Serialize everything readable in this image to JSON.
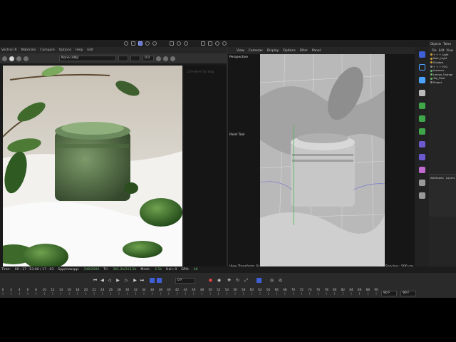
{
  "viewer": {
    "menu": [
      "Vectron R",
      "Materials",
      "Compare",
      "Options",
      "Help",
      "Edit"
    ],
    "camera_select": "None (ANJ)",
    "field_value": "0.0",
    "side_note": "Ctrl+Alt+F for help"
  },
  "viewport": {
    "menu": [
      "View",
      "Cameras",
      "Display",
      "Options",
      "Filter",
      "Panel"
    ],
    "title": "Perspective",
    "tool_label": "Point Tool",
    "view_transform": "View Transform: Scene",
    "grid_spacing": "Grid Spacing : 500 cm"
  },
  "object_manager": {
    "header": [
      "Objects",
      "Takes"
    ],
    "menu": [
      "File",
      "Edit",
      "View"
    ],
    "objects": [
      {
        "name": "+ + + Light",
        "color": "#d9a23b"
      },
      {
        "name": "Main_Light",
        "color": "#d9a23b"
      },
      {
        "name": "Shadow",
        "color": "#d9a23b"
      },
      {
        "name": "+ + + FOG",
        "color": "#8a8a8a"
      },
      {
        "name": "Instance",
        "color": "#6fb86f"
      },
      {
        "name": "Lemon_Orange",
        "color": "#6fb86f"
      },
      {
        "name": "Top_Floor",
        "color": "#6fb86f"
      },
      {
        "name": "Project",
        "color": "#8a8a8a"
      }
    ],
    "attr_tabs": [
      "Attributes",
      "Layers"
    ]
  },
  "status": {
    "time_label": "Time:",
    "time_value": "00 : 17 : 03:00 / 17 : 03",
    "spp_label": "Spp/maxspp:",
    "spp_value": "348/2000",
    "tri_label": "Tri:",
    "tri_value": "361.2k/113.2k",
    "mesh_label": "Mesh:",
    "mesh_value": "4.1k",
    "hair_label": "Hair: 0",
    "gpu_label": "GPU:",
    "gpu_value": "48"
  },
  "timeline": {
    "current_frame": "0 F",
    "end_frame_a": "90 F",
    "end_frame_b": "90 F",
    "ticks": [
      "0",
      "2",
      "4",
      "6",
      "8",
      "10",
      "12",
      "14",
      "16",
      "18",
      "20",
      "22",
      "24",
      "26",
      "28",
      "30",
      "32",
      "34",
      "36",
      "38",
      "40",
      "42",
      "44",
      "46",
      "48",
      "50",
      "52",
      "54",
      "56",
      "58",
      "60",
      "62",
      "64",
      "66",
      "68",
      "70",
      "72",
      "74",
      "76",
      "78",
      "80",
      "82",
      "84",
      "86",
      "88",
      "90"
    ]
  },
  "colors": {
    "accent": "#6a7ad8",
    "active_tool": "#3e5fd6",
    "green_status": "#6fb86f"
  }
}
